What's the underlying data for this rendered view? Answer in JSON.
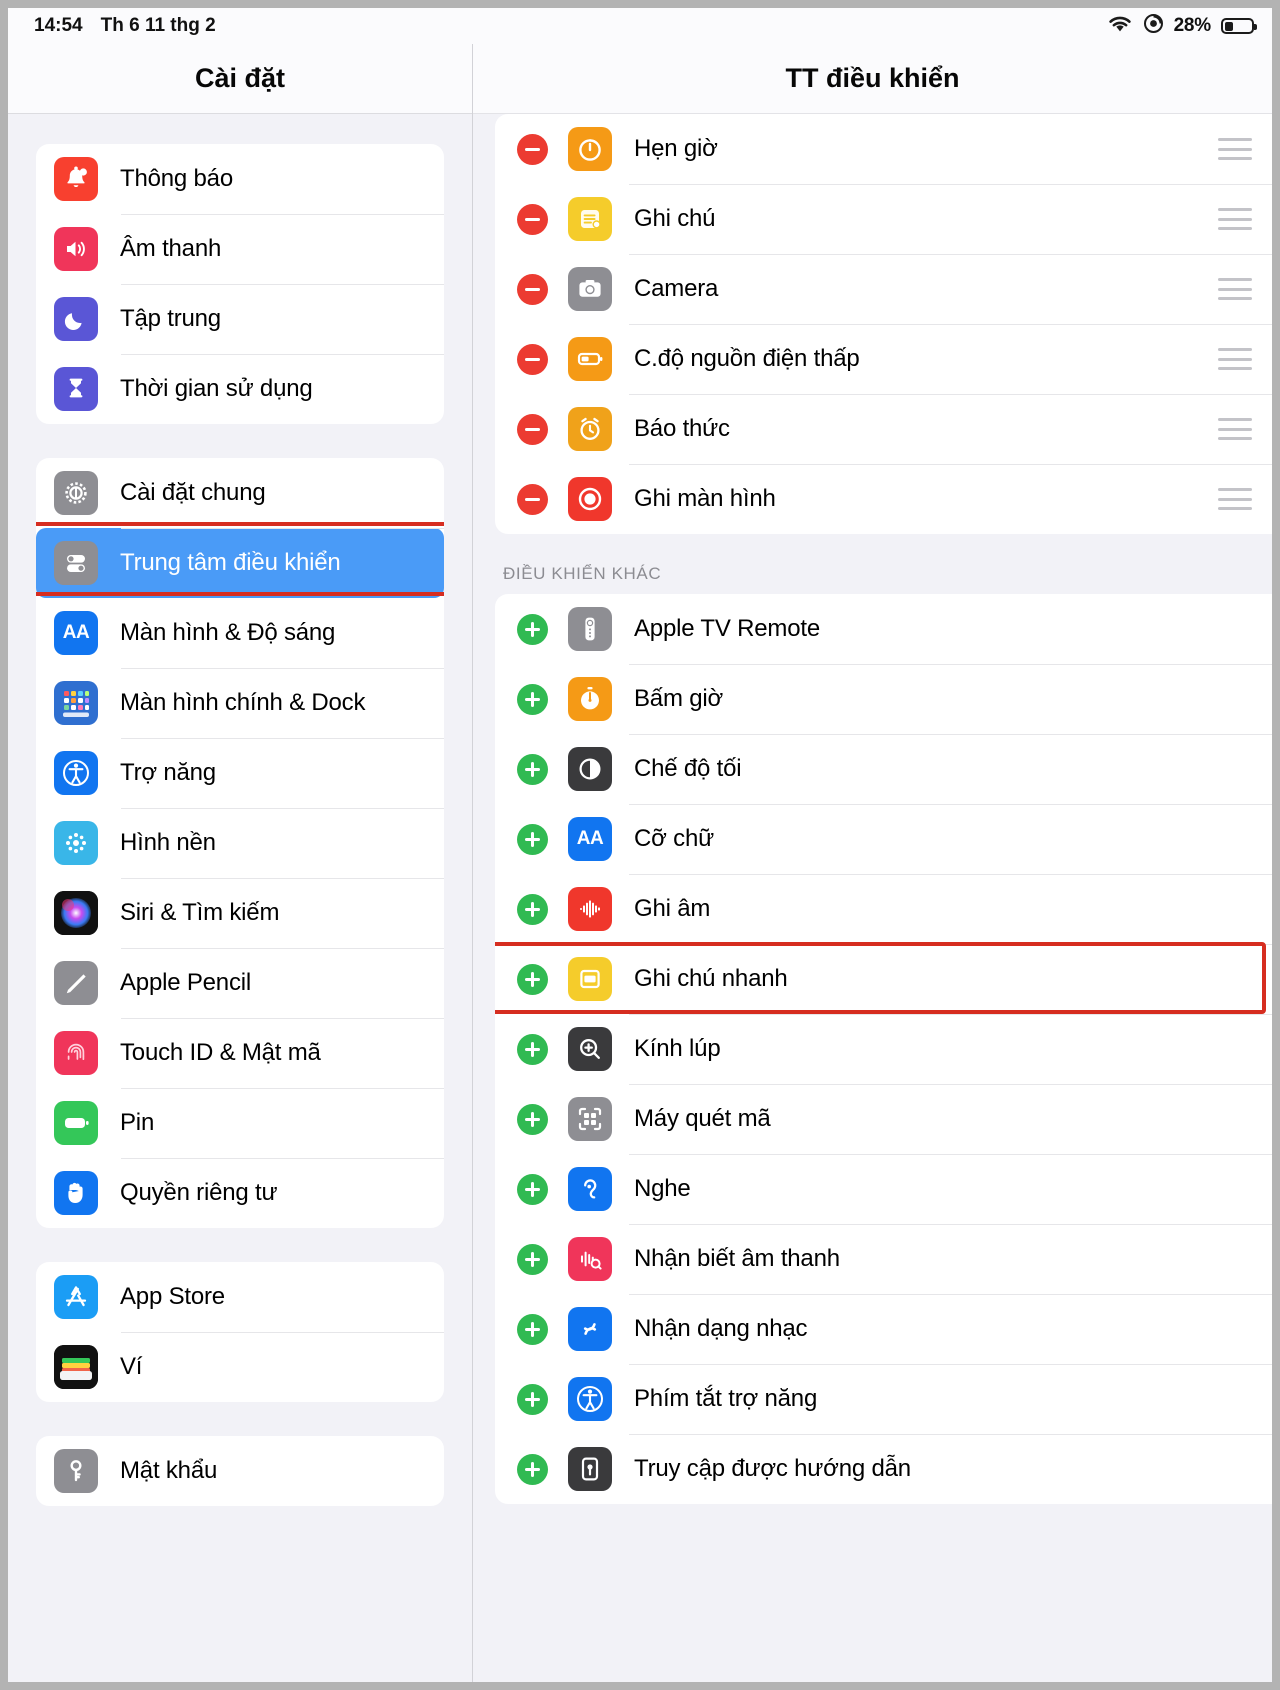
{
  "statusbar": {
    "time": "14:54",
    "date": "Th 6 11 thg 2",
    "battery_percent": "28%",
    "wifi_icon": "wifi-icon",
    "orientation_lock_icon": "rotation-lock-icon",
    "battery_icon": "battery-icon"
  },
  "sidebar": {
    "title": "Cài đặt",
    "groups": [
      {
        "items": [
          {
            "label": "Thông báo",
            "icon": "notifications-icon"
          },
          {
            "label": "Âm thanh",
            "icon": "sounds-icon"
          },
          {
            "label": "Tập trung",
            "icon": "focus-icon"
          },
          {
            "label": "Thời gian sử dụng",
            "icon": "screen-time-icon"
          }
        ]
      },
      {
        "items": [
          {
            "label": "Cài đặt chung",
            "icon": "general-settings-icon",
            "selected": false
          },
          {
            "label": "Trung tâm điều khiển",
            "icon": "control-center-icon",
            "selected": true
          },
          {
            "label": "Màn hình & Độ sáng",
            "icon": "display-brightness-icon",
            "selected": false
          },
          {
            "label": "Màn hình chính & Dock",
            "icon": "home-screen-dock-icon",
            "selected": false
          },
          {
            "label": "Trợ năng",
            "icon": "accessibility-icon",
            "selected": false
          },
          {
            "label": "Hình nền",
            "icon": "wallpaper-icon",
            "selected": false
          },
          {
            "label": "Siri & Tìm kiếm",
            "icon": "siri-search-icon",
            "selected": false
          },
          {
            "label": "Apple Pencil",
            "icon": "apple-pencil-icon",
            "selected": false
          },
          {
            "label": "Touch ID & Mật mã",
            "icon": "touch-id-icon",
            "selected": false
          },
          {
            "label": "Pin",
            "icon": "battery-settings-icon",
            "selected": false
          },
          {
            "label": "Quyền riêng tư",
            "icon": "privacy-icon",
            "selected": false
          }
        ]
      },
      {
        "items": [
          {
            "label": "App Store",
            "icon": "app-store-icon"
          },
          {
            "label": "Ví",
            "icon": "wallet-icon"
          }
        ]
      },
      {
        "items": [
          {
            "label": "Mật khẩu",
            "icon": "passwords-icon"
          }
        ]
      }
    ]
  },
  "detail": {
    "title": "TT điều khiển",
    "included_controls": [
      {
        "label": "Hẹn giờ",
        "icon": "timer-icon",
        "action": "remove",
        "drag_handle": "reorder-grip-icon"
      },
      {
        "label": "Ghi chú",
        "icon": "notes-icon",
        "action": "remove",
        "drag_handle": "reorder-grip-icon"
      },
      {
        "label": "Camera",
        "icon": "camera-icon",
        "action": "remove",
        "drag_handle": "reorder-grip-icon"
      },
      {
        "label": "C.độ nguồn điện thấp",
        "icon": "low-power-mode-icon",
        "action": "remove",
        "drag_handle": "reorder-grip-icon"
      },
      {
        "label": "Báo thức",
        "icon": "alarm-icon",
        "action": "remove",
        "drag_handle": "reorder-grip-icon"
      },
      {
        "label": "Ghi màn hình",
        "icon": "screen-recording-icon",
        "action": "remove",
        "drag_handle": "reorder-grip-icon"
      }
    ],
    "more_controls_header": "ĐIỀU KHIỂN KHÁC",
    "more_controls": [
      {
        "label": "Apple TV Remote",
        "icon": "apple-tv-remote-icon",
        "action": "add",
        "highlighted": false
      },
      {
        "label": "Bấm giờ",
        "icon": "stopwatch-icon",
        "action": "add",
        "highlighted": false
      },
      {
        "label": "Chế độ tối",
        "icon": "dark-mode-icon",
        "action": "add",
        "highlighted": false
      },
      {
        "label": "Cỡ chữ",
        "icon": "text-size-icon",
        "action": "add",
        "highlighted": false
      },
      {
        "label": "Ghi âm",
        "icon": "voice-memos-icon",
        "action": "add",
        "highlighted": false
      },
      {
        "label": "Ghi chú nhanh",
        "icon": "quick-note-icon",
        "action": "add",
        "highlighted": true
      },
      {
        "label": "Kính lúp",
        "icon": "magnifier-icon",
        "action": "add",
        "highlighted": false
      },
      {
        "label": "Máy quét mã",
        "icon": "code-scanner-icon",
        "action": "add",
        "highlighted": false
      },
      {
        "label": "Nghe",
        "icon": "hearing-icon",
        "action": "add",
        "highlighted": false
      },
      {
        "label": "Nhận biết âm thanh",
        "icon": "sound-recognition-icon",
        "action": "add",
        "highlighted": false
      },
      {
        "label": "Nhận dạng nhạc",
        "icon": "music-recognition-icon",
        "action": "add",
        "highlighted": false
      },
      {
        "label": "Phím tắt trợ năng",
        "icon": "accessibility-shortcut-icon",
        "action": "add",
        "highlighted": false
      },
      {
        "label": "Truy cập được hướng dẫn",
        "icon": "guided-access-icon",
        "action": "add",
        "highlighted": false
      }
    ]
  },
  "colors": {
    "selection_blue": "#4a9bf7",
    "annotation_red": "#d62d20",
    "add_green": "#30ba52",
    "remove_red": "#ec3b31",
    "page_background": "#f2f2f7"
  }
}
